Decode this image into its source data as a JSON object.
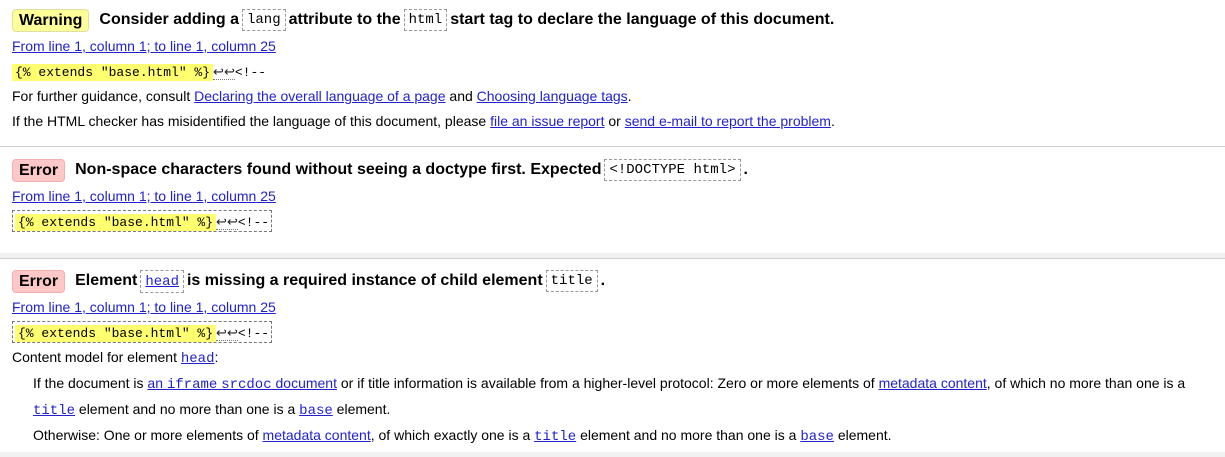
{
  "messages": [
    {
      "badge": "Warning",
      "title_before": "Consider adding a",
      "code1": "lang",
      "title_mid": "attribute to the",
      "code2": "html",
      "title_after": "start tag to declare the language of this document.",
      "location": "From line 1, column 1; to line 1, column 25",
      "extract_highlight": "{% extends \"base.html\" %}",
      "extract_rest": "<!--",
      "guidance_prefix": "For further guidance, consult",
      "guidance_link1": "Declaring the overall language of a page",
      "guidance_and": "and",
      "guidance_link2": "Choosing language tags",
      "guidance_end": ".",
      "report_prefix": "If the HTML checker has misidentified the language of this document, please",
      "report_link1": "file an issue report",
      "report_or": "or",
      "report_link2": "send e-mail to report the problem",
      "report_end": "."
    },
    {
      "badge": "Error",
      "title_before": "Non-space characters found without seeing a doctype first. Expected",
      "code1": "<!DOCTYPE html>",
      "title_after": ".",
      "location": "From line 1, column 1; to line 1, column 25",
      "extract_highlight": "{% extends \"base.html\" %}",
      "extract_rest": "<!--"
    },
    {
      "badge": "Error",
      "title_before": "Element",
      "code1": "head",
      "title_mid": "is missing a required instance of child element",
      "code2": "title",
      "title_after": ".",
      "location": "From line 1, column 1; to line 1, column 25",
      "extract_highlight": "{% extends \"base.html\" %}",
      "extract_rest": "<!--",
      "content_model_prefix": "Content model for element",
      "content_model_code": "head",
      "content_model_suffix": ":",
      "cm1_prefix": "If the document is",
      "cm1_link_an": "an",
      "cm1_link_code": "iframe",
      "cm1_link_code2": "srcdoc",
      "cm1_link_doc": "document",
      "cm1_mid": "or if title information is available from a higher-level protocol: Zero or more elements of",
      "cm1_link_metadata": "metadata content",
      "cm1_after": ", of which no more than one is a",
      "cm1_line2_code_title": "title",
      "cm1_line2_mid": "element and no more than one is a",
      "cm1_line2_code_base": "base",
      "cm1_line2_end": "element.",
      "cm2_prefix": "Otherwise: One or more elements of",
      "cm2_link_metadata": "metadata content",
      "cm2_mid": ", of which exactly one is a",
      "cm2_code_title": "title",
      "cm2_mid2": "element and no more than one is a",
      "cm2_code_base": "base",
      "cm2_end": "element."
    }
  ],
  "return_symbol": "↩↩",
  "colors": {
    "warning_badge": "#ffff99",
    "error_badge": "#ffc8c8",
    "link": "#2222cc",
    "highlight": "#ffff70"
  }
}
